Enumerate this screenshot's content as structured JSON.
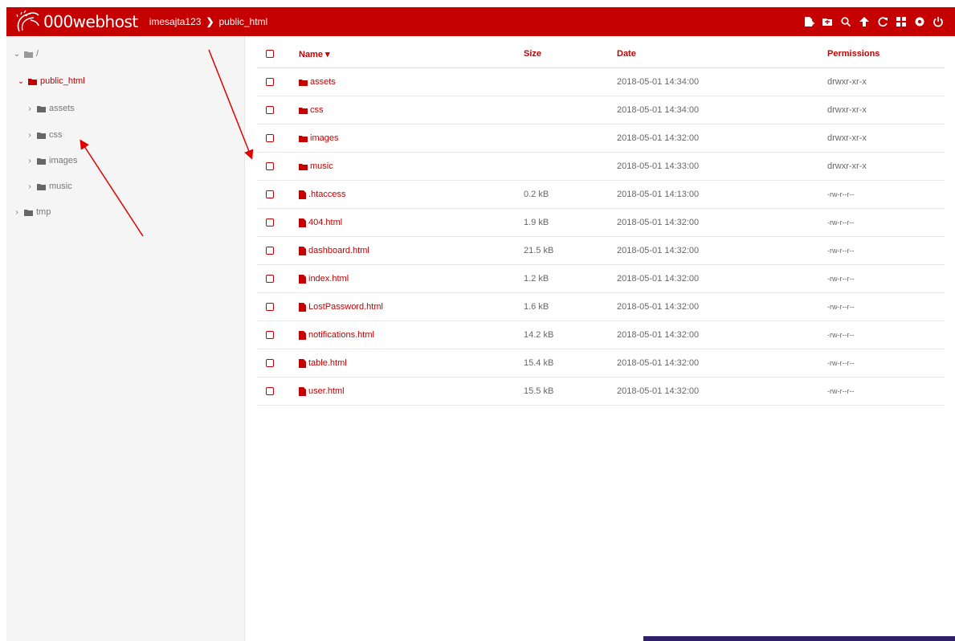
{
  "header": {
    "brand": "000webhost",
    "breadcrumb": [
      "imesajta123",
      "public_html"
    ],
    "accent_color": "#c40000",
    "tools": [
      "new-file-icon",
      "new-folder-icon",
      "search-icon",
      "upload-icon",
      "refresh-icon",
      "grid-view-icon",
      "settings-icon",
      "power-icon"
    ]
  },
  "sidebar": {
    "root_label": "/",
    "items": [
      {
        "label": "public_html",
        "expanded": true,
        "active": true
      },
      {
        "label": "assets"
      },
      {
        "label": "css"
      },
      {
        "label": "images"
      },
      {
        "label": "music"
      },
      {
        "label": "tmp"
      }
    ]
  },
  "table": {
    "columns": {
      "name": "Name ▾",
      "size": "Size",
      "date": "Date",
      "permissions": "Permissions"
    },
    "rows": [
      {
        "type": "folder",
        "name": "assets",
        "size": "",
        "date": "2018-05-01 14:34:00",
        "perm": "drwxr-xr-x"
      },
      {
        "type": "folder",
        "name": "css",
        "size": "",
        "date": "2018-05-01 14:34:00",
        "perm": "drwxr-xr-x"
      },
      {
        "type": "folder",
        "name": "images",
        "size": "",
        "date": "2018-05-01 14:32:00",
        "perm": "drwxr-xr-x"
      },
      {
        "type": "folder",
        "name": "music",
        "size": "",
        "date": "2018-05-01 14:33:00",
        "perm": "drwxr-xr-x"
      },
      {
        "type": "file",
        "name": ".htaccess",
        "size": "0.2 kB",
        "date": "2018-05-01 14:13:00",
        "perm": "-rw-r--r--"
      },
      {
        "type": "file",
        "name": "404.html",
        "size": "1.9 kB",
        "date": "2018-05-01 14:32:00",
        "perm": "-rw-r--r--"
      },
      {
        "type": "file",
        "name": "dashboard.html",
        "size": "21.5 kB",
        "date": "2018-05-01 14:32:00",
        "perm": "-rw-r--r--"
      },
      {
        "type": "file",
        "name": "index.html",
        "size": "1.2 kB",
        "date": "2018-05-01 14:32:00",
        "perm": "-rw-r--r--"
      },
      {
        "type": "file",
        "name": "LostPassword.html",
        "size": "1.6 kB",
        "date": "2018-05-01 14:32:00",
        "perm": "-rw-r--r--"
      },
      {
        "type": "file",
        "name": "notifications.html",
        "size": "14.2 kB",
        "date": "2018-05-01 14:32:00",
        "perm": "-rw-r--r--"
      },
      {
        "type": "file",
        "name": "table.html",
        "size": "15.4 kB",
        "date": "2018-05-01 14:32:00",
        "perm": "-rw-r--r--"
      },
      {
        "type": "file",
        "name": "user.html",
        "size": "15.5 kB",
        "date": "2018-05-01 14:32:00",
        "perm": "-rw-r--r--"
      }
    ]
  }
}
